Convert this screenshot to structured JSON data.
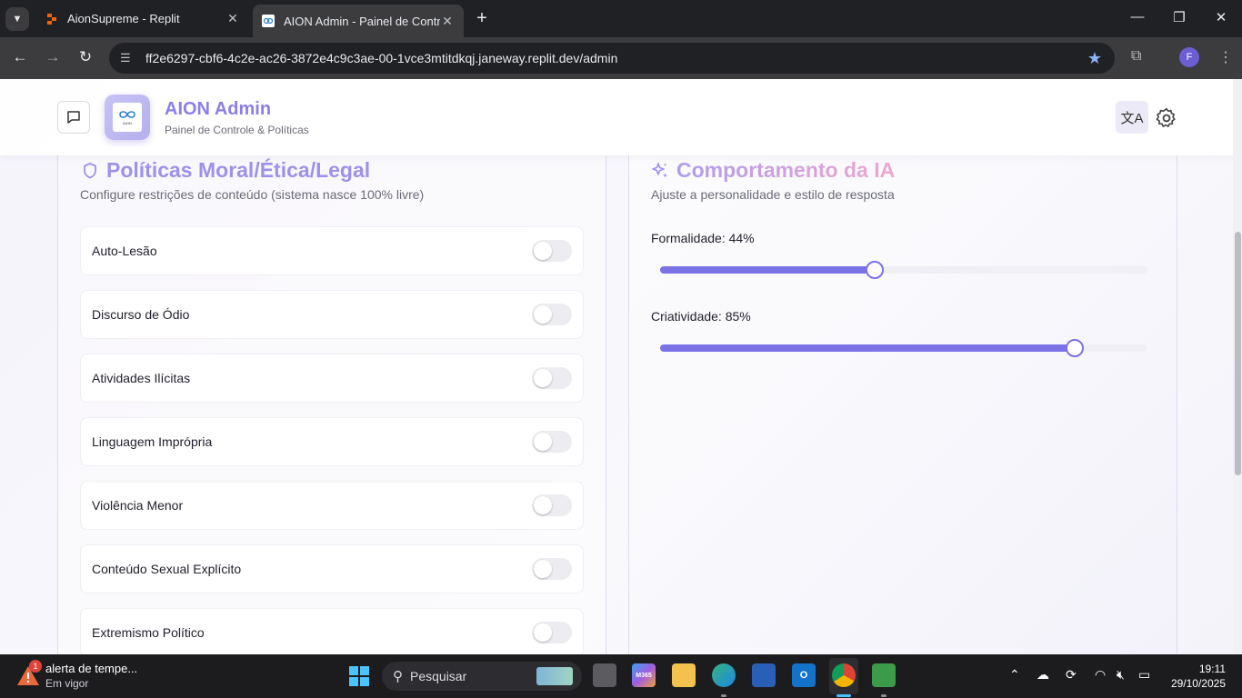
{
  "browser": {
    "tabs": [
      {
        "title": "AionSupreme - Replit",
        "active": false
      },
      {
        "title": "AION Admin - Painel de Contro",
        "active": true
      }
    ],
    "url": "ff2e6297-cbf6-4c2e-ac26-3872e4c9c3ae-00-1vce3mtitdkqj.janeway.replit.dev/admin",
    "profile_initial": "F"
  },
  "header": {
    "logo_text": "AION",
    "title": "AION Admin",
    "subtitle": "Painel de Controle & Políticas"
  },
  "policies_card": {
    "title": "Políticas Moral/Ética/Legal",
    "description": "Configure restrições de conteúdo (sistema nasce 100% livre)",
    "items": [
      {
        "label": "Auto-Lesão",
        "enabled": false
      },
      {
        "label": "Discurso de Ódio",
        "enabled": false
      },
      {
        "label": "Atividades Ilícitas",
        "enabled": false
      },
      {
        "label": "Linguagem Imprópria",
        "enabled": false
      },
      {
        "label": "Violência Menor",
        "enabled": false
      },
      {
        "label": "Conteúdo Sexual Explícito",
        "enabled": false
      },
      {
        "label": "Extremismo Político",
        "enabled": false
      }
    ]
  },
  "behavior_card": {
    "title": "Comportamento da IA",
    "description": "Ajuste a personalidade e estilo de resposta",
    "sliders": [
      {
        "label": "Formalidade: 44%",
        "value": 0.44
      },
      {
        "label": "Criatividade: 85%",
        "value": 0.85
      }
    ]
  },
  "taskbar": {
    "weather_badge": "1",
    "weather_title": "alerta de tempe...",
    "weather_sub": "Em vigor",
    "search_placeholder": "Pesquisar",
    "time": "19:11",
    "date": "29/10/2025"
  },
  "colors": {
    "accent": "#7b72e6",
    "title_purple": "#8b7fe8",
    "title_pink": "#f0a6cf"
  }
}
